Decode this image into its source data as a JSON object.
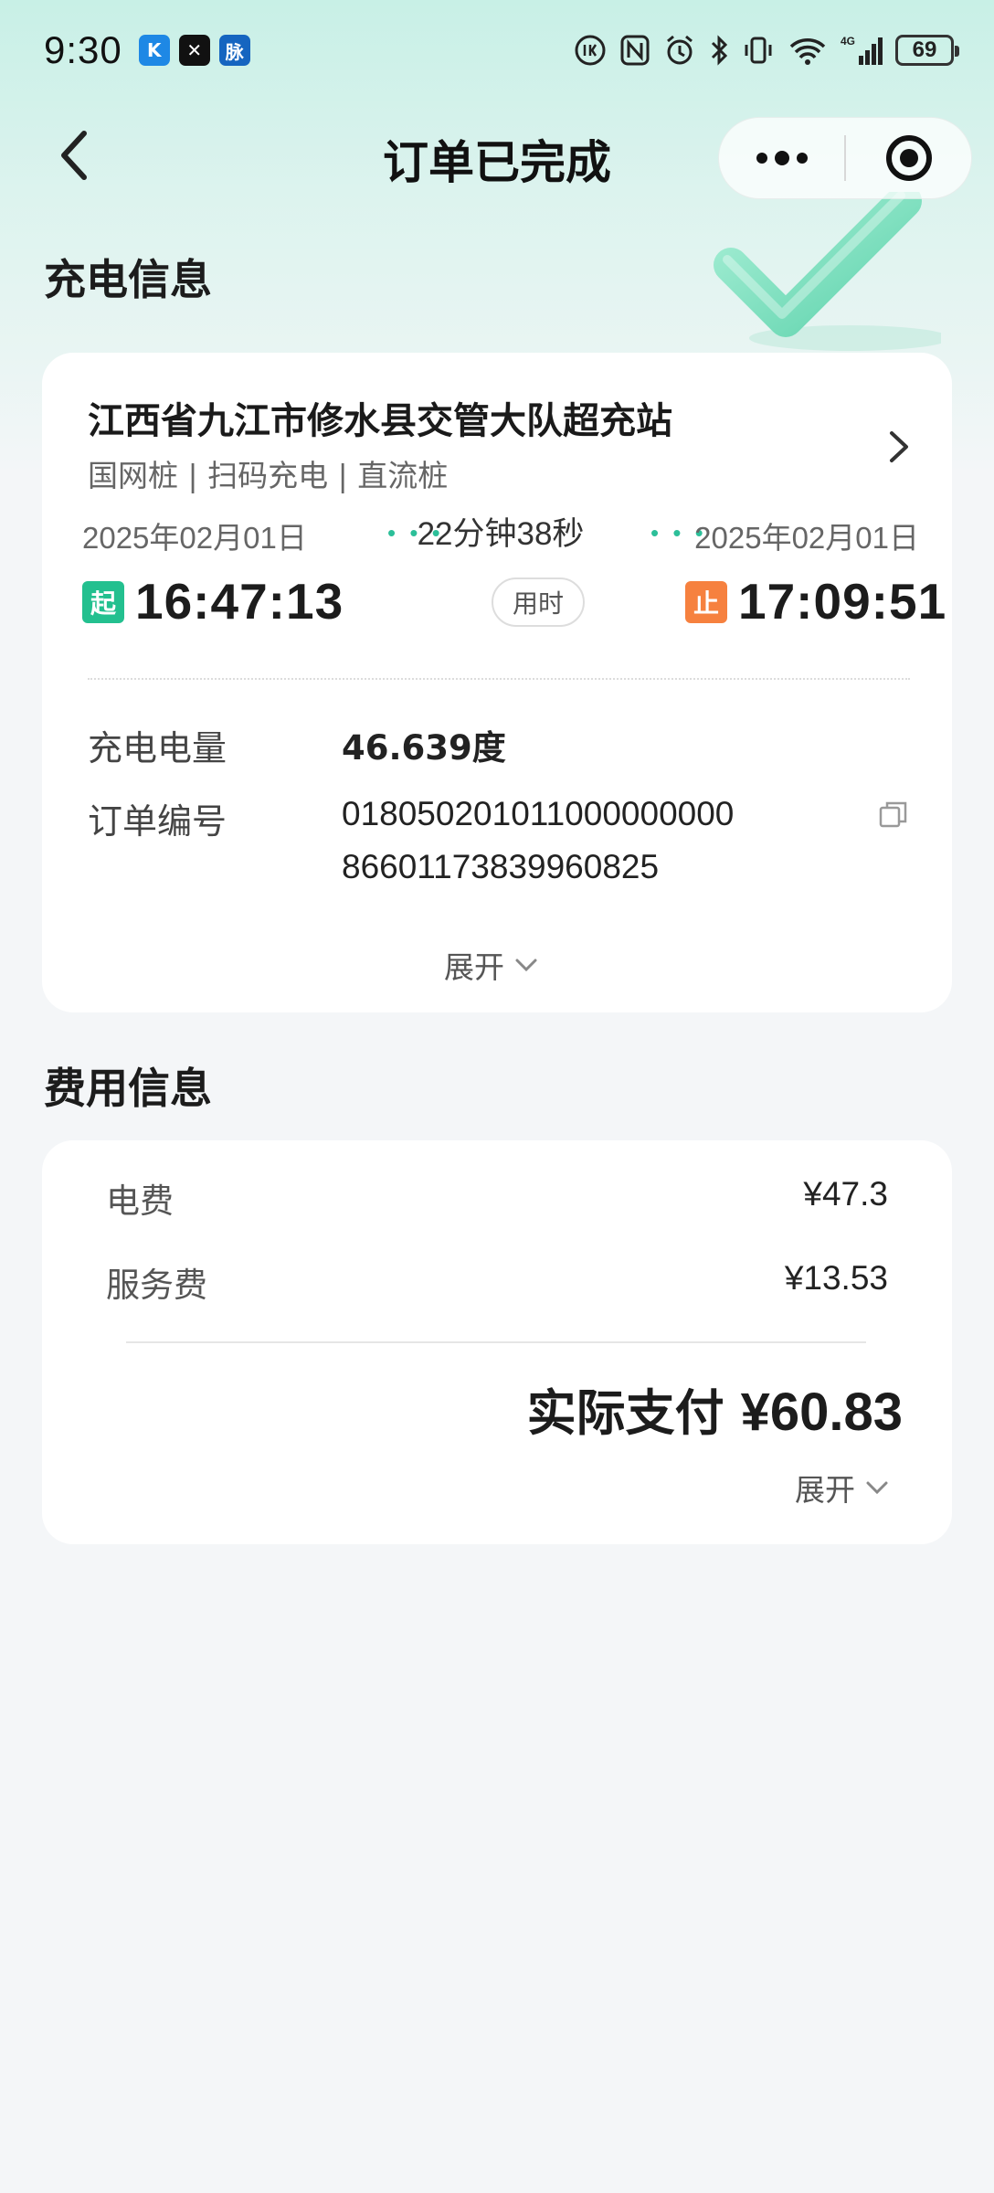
{
  "status_bar": {
    "time": "9:30",
    "apps": [
      {
        "icon": "k-app-icon",
        "text": "K",
        "color": "#1e88e5"
      },
      {
        "icon": "x-app-icon",
        "text": "✕",
        "color": "#111111"
      },
      {
        "icon": "mai-app-icon",
        "text": "脉",
        "color": "#1565c0"
      }
    ],
    "network": "4G",
    "battery": "69"
  },
  "nav": {
    "title": "订单已完成"
  },
  "charging_section": {
    "title": "充电信息",
    "station_name": "江西省九江市修水县交管大队超充站",
    "station_tags": "国网桩 | 扫码充电 | 直流桩",
    "start_date": "2025年02月01日",
    "end_date": "2025年02月01日",
    "duration": "22分钟38秒",
    "start_tag": "起",
    "start_time": "16:47:13",
    "use_label": "用时",
    "end_tag": "止",
    "end_time": "17:09:51",
    "energy_label": "充电电量",
    "energy_value": "46.639度",
    "order_label": "订单编号",
    "order_no_line1": "018050201011000000000",
    "order_no_line2": "86601173839960825",
    "expand_label": "展开"
  },
  "fee_section": {
    "title": "费用信息",
    "electricity_label": "电费",
    "electricity_value": "¥47.3",
    "service_label": "服务费",
    "service_value": "¥13.53",
    "total_label": "实际支付",
    "total_value": "¥60.83",
    "expand_label": "展开"
  },
  "colors": {
    "accent_green": "#23c08f",
    "end_orange": "#f6813f",
    "header_mint": "#c8f0e6"
  }
}
